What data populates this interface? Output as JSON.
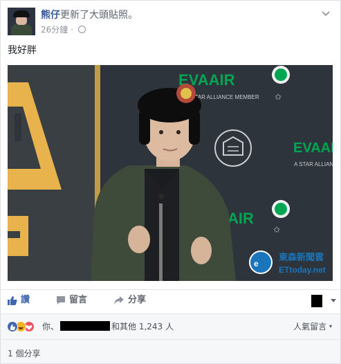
{
  "post": {
    "author": "熊仔",
    "action": "更新了大頭貼照。",
    "time": "26分鐘",
    "separator": "·",
    "privacy_icon": "globe-icon",
    "text": "我好胖"
  },
  "photo": {
    "sponsor_brand": "EVAAIR",
    "alliance_text": "A STAR ALLIANCE MEMBER",
    "watermark_cn": "東森新聞雲",
    "watermark_en": "ETtoday.net"
  },
  "actions": {
    "like": "讚",
    "comment": "留言",
    "share": "分享"
  },
  "reactions": {
    "icons": [
      "like-icon",
      "haha-icon",
      "love-icon"
    ],
    "prefix": "你、",
    "suffix": "和其他 1,243 人",
    "sort_label": "人氣留言"
  },
  "shares": {
    "count_text": "1 個分享"
  },
  "colors": {
    "link_blue": "#365899",
    "like_blue": "#4267b2",
    "secondary": "#90949c",
    "eva_green": "#00a651"
  }
}
